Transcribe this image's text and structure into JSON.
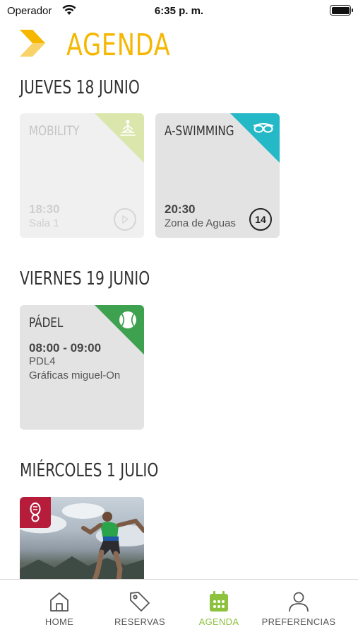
{
  "status_bar": {
    "carrier": "Operador",
    "time": "6:35 p. m."
  },
  "header": {
    "title": "AGENDA",
    "accent_color": "#f5b700"
  },
  "days": [
    {
      "label": "JUEVES 18 JUNIO",
      "sessions": [
        {
          "name": "MOBILITY",
          "time": "18:30",
          "place": "Sala 1",
          "icon": "yoga-icon",
          "corner_color": "#dbe6ad",
          "spots_icon": "play-icon",
          "disabled": true
        },
        {
          "name": "A-SWIMMING",
          "time": "20:30",
          "place": "Zona de Aguas",
          "icon": "swim-goggles-icon",
          "corner_color": "#25b8c6",
          "spots": "14",
          "disabled": false
        }
      ]
    },
    {
      "label": "VIERNES 19 JUNIO",
      "sessions": [
        {
          "name": "PÁDEL",
          "time": "08:00 - 09:00",
          "place": "PDL4",
          "extra": "Gráficas miguel-On",
          "icon": "tennis-ball-icon",
          "corner_color": "#3ea14f"
        }
      ]
    },
    {
      "label": "MIÉRCOLES 1 JULIO",
      "sessions": [
        {
          "icon": "shoe-print-icon",
          "corner_color": "#b51d3b"
        }
      ]
    }
  ],
  "tab_bar": {
    "active_color": "#8dc23f",
    "tabs": [
      {
        "label": "HOME",
        "icon": "home-icon"
      },
      {
        "label": "RESERVAS",
        "icon": "tag-icon"
      },
      {
        "label": "AGENDA",
        "icon": "calendar-icon",
        "active": true
      },
      {
        "label": "PREFERENCIAS",
        "icon": "user-icon"
      }
    ]
  }
}
